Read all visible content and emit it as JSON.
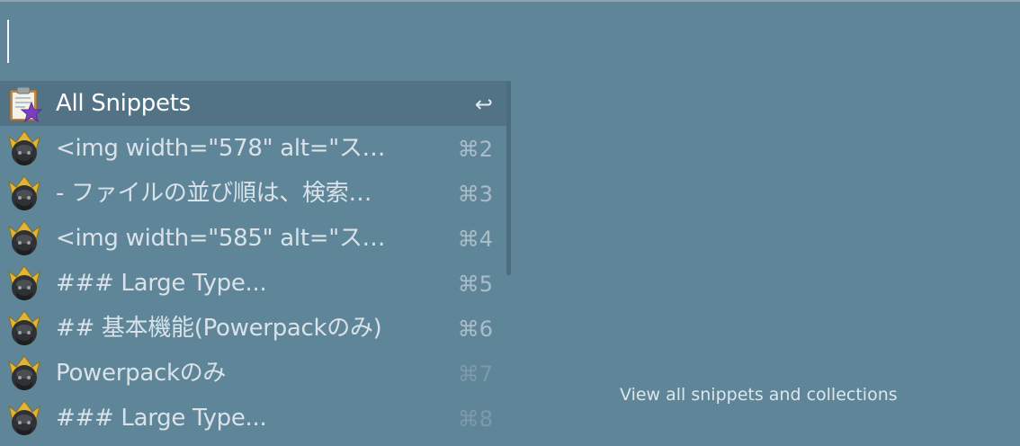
{
  "search": {
    "value": "",
    "placeholder": ""
  },
  "results": [
    {
      "title": "All Snippets",
      "shortcut": "↩",
      "icon": "clipboard-star-icon",
      "selected": true
    },
    {
      "title": "<img width=\"578\" alt=\"ス…",
      "shortcut": "⌘2",
      "icon": "alfred-hat-icon"
    },
    {
      "title": "- ファイルの並び順は、検索…",
      "shortcut": "⌘3",
      "icon": "alfred-hat-icon"
    },
    {
      "title": "<img width=\"585\" alt=\"ス…",
      "shortcut": "⌘4",
      "icon": "alfred-hat-icon"
    },
    {
      "title": "### Large Type...",
      "shortcut": "⌘5",
      "icon": "alfred-hat-icon"
    },
    {
      "title": "## 基本機能(Powerpackのみ)",
      "shortcut": "⌘6",
      "icon": "alfred-hat-icon"
    },
    {
      "title": "Powerpackのみ",
      "shortcut": "⌘7",
      "icon": "alfred-hat-icon"
    },
    {
      "title": "### Large Type...",
      "shortcut": "⌘8",
      "icon": "alfred-hat-icon"
    }
  ],
  "hint": "View all snippets and collections",
  "colors": {
    "background": "#5f8598",
    "selected_row": "#527286",
    "text": "#d8e2e8"
  }
}
